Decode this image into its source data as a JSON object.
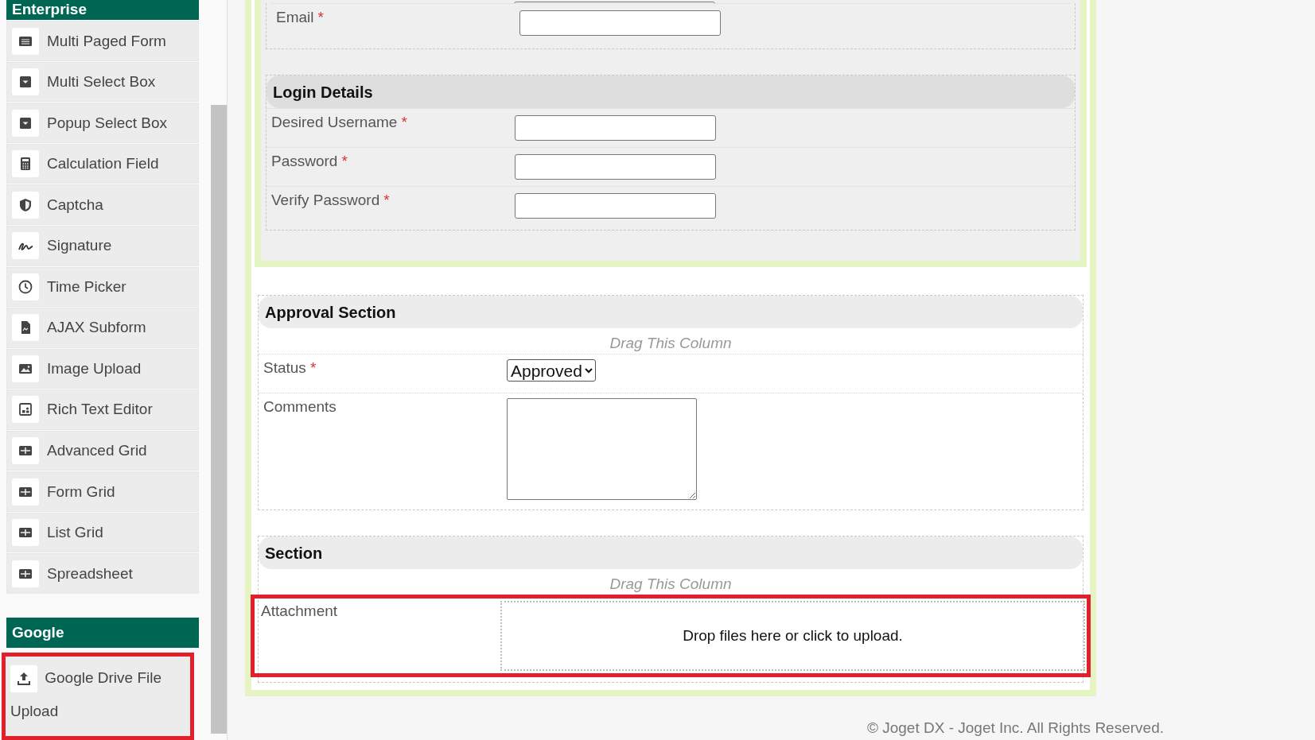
{
  "sidebar": {
    "categories": [
      {
        "title": "Enterprise",
        "items": [
          {
            "label": "Multi Paged Form",
            "highlighted": false
          },
          {
            "label": "Multi Select Box",
            "highlighted": false
          },
          {
            "label": "Popup Select Box",
            "highlighted": false
          },
          {
            "label": "Calculation Field",
            "highlighted": false
          },
          {
            "label": "Captcha",
            "highlighted": false
          },
          {
            "label": "Signature",
            "highlighted": false
          },
          {
            "label": "Time Picker",
            "highlighted": false
          },
          {
            "label": "AJAX Subform",
            "highlighted": false
          },
          {
            "label": "Image Upload",
            "highlighted": false
          },
          {
            "label": "Rich Text Editor",
            "highlighted": false
          },
          {
            "label": "Advanced Grid",
            "highlighted": false
          },
          {
            "label": "Form Grid",
            "highlighted": false
          },
          {
            "label": "List Grid",
            "highlighted": false
          },
          {
            "label": "Spreadsheet",
            "highlighted": false
          }
        ]
      },
      {
        "title": "Google",
        "items": [
          {
            "label": "Google Drive File Upload",
            "highlighted": true
          }
        ]
      }
    ]
  },
  "form": {
    "top_group": {
      "rows": [
        {
          "kind": "text",
          "label": "Email",
          "required_mark": "*"
        }
      ],
      "sections": [
        {
          "title": "Login Details",
          "rows": [
            {
              "kind": "text",
              "label": "Desired Username",
              "required_mark": "*"
            },
            {
              "kind": "text",
              "label": "Password",
              "required_mark": "*"
            },
            {
              "kind": "text",
              "label": "Verify Password",
              "required_mark": "*"
            }
          ]
        }
      ]
    },
    "sections": [
      {
        "title": "Approval Section",
        "column_hint": "Drag This Column",
        "rows": [
          {
            "kind": "select",
            "label": "Status",
            "required_mark": "*",
            "value": "Approved",
            "highlighted": false
          },
          {
            "kind": "textarea",
            "label": "Comments",
            "highlighted": false
          }
        ]
      },
      {
        "title": "Section",
        "column_hint": "Drag This Column",
        "rows": [
          {
            "kind": "file",
            "label": "Attachment",
            "placeholder": "Drop files here or click to upload.",
            "highlighted": true
          }
        ]
      }
    ]
  },
  "footer": {
    "text": "© Joget DX - Joget Inc. All Rights Reserved."
  }
}
